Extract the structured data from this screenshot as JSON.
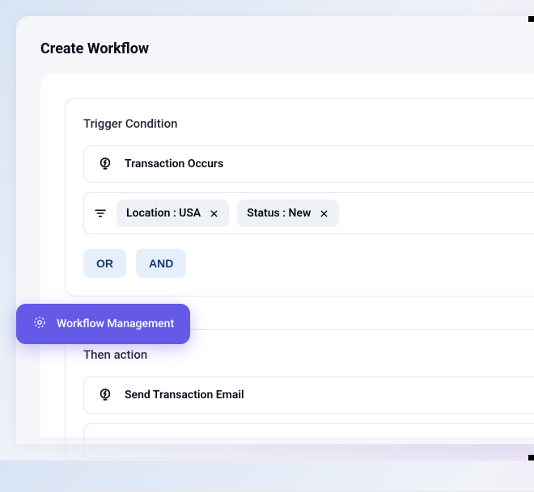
{
  "page": {
    "title": "Create Workflow"
  },
  "trigger": {
    "section_title": "Trigger Condition",
    "event_label": "Transaction Occurs",
    "filters": [
      {
        "label": "Location : USA"
      },
      {
        "label": "Status : New"
      }
    ],
    "logic": {
      "or": "OR",
      "and": "AND"
    }
  },
  "action": {
    "section_title": "Then action",
    "action_label": "Send Transaction Email"
  },
  "floating_badge": {
    "label": "Workflow Management"
  }
}
